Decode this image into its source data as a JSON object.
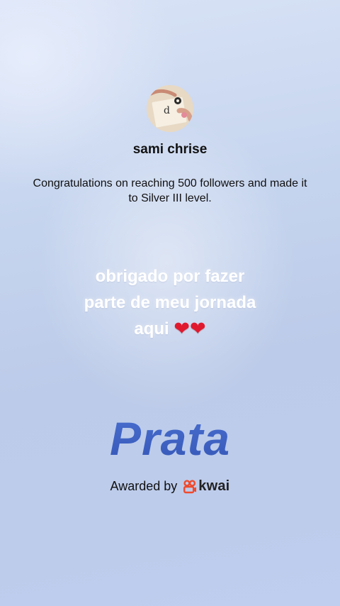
{
  "profile": {
    "username": "sami chrise"
  },
  "award": {
    "congrats_text": "Congratulations on reaching 500 followers and made it to Silver III level.",
    "level_name": "Prata",
    "awarded_by_label": "Awarded by",
    "brand_name": "kwai"
  },
  "message": {
    "line1": "obrigado por fazer",
    "line2": "parte de meu jornada",
    "line3": "aqui",
    "hearts": "❤❤"
  },
  "icons": {
    "avatar": "profile-avatar",
    "brand": "kwai-logo-icon",
    "hearts": "red-heart-emoji"
  },
  "colors": {
    "level_title": "#3f5fc1",
    "brand_logo": "#f04a2c",
    "heart": "#e0192f"
  }
}
